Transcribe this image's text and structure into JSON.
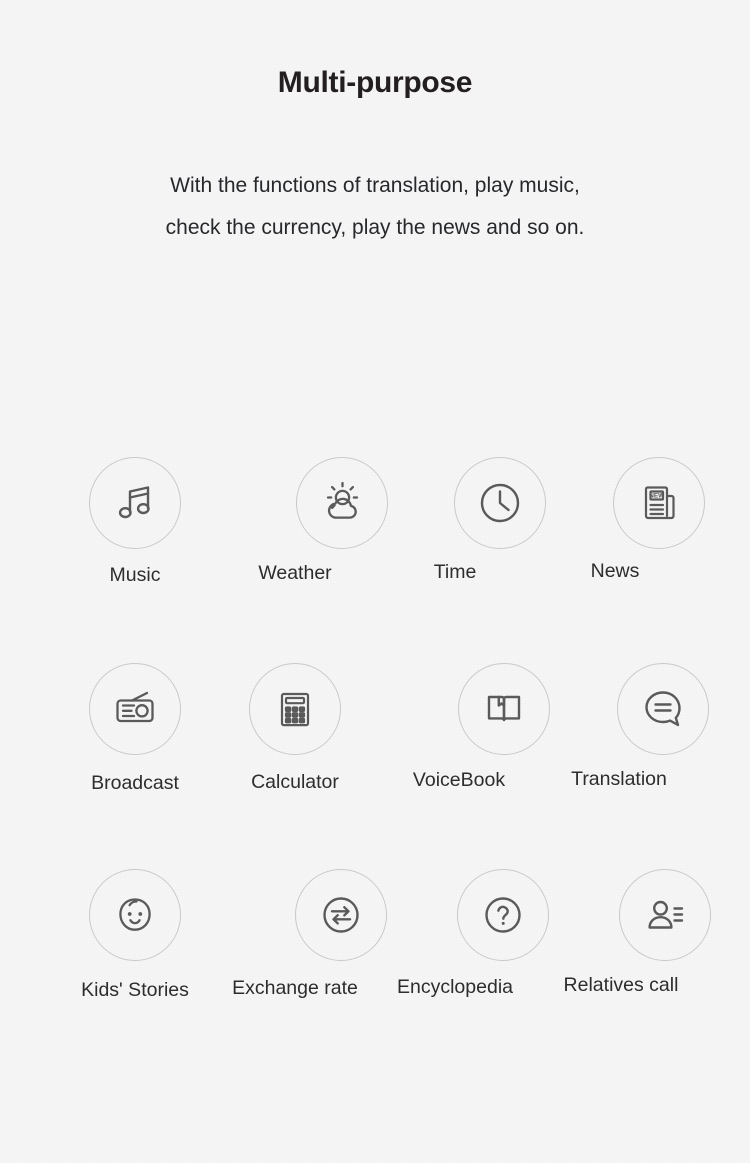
{
  "headline": "Multi-purpose",
  "subtitle": {
    "line1": "With the functions of translation, play music,",
    "line2": "check the currency, play the news and so on."
  },
  "colors": {
    "background": "#f5f5f5",
    "heading_text": "#231f20",
    "body_text": "#26282b",
    "circle_border": "#c9c9c9",
    "icon_stroke": "#5a5a5a"
  },
  "features": {
    "rows": [
      {
        "items": [
          {
            "label": "Music",
            "icon": "music-note-icon"
          },
          {
            "label": "Weather",
            "icon": "sun-behind-cloud-icon"
          },
          {
            "label": "Time",
            "icon": "clock-icon"
          },
          {
            "label": "News",
            "icon": "newspaper-icon",
            "icon_text": "NEW"
          }
        ]
      },
      {
        "items": [
          {
            "label": "Broadcast",
            "icon": "radio-icon"
          },
          {
            "label": "Calculator",
            "icon": "calculator-icon"
          },
          {
            "label": "VoiceBook",
            "icon": "open-book-icon"
          },
          {
            "label": "Translation",
            "icon": "speech-bubble-equals-icon"
          }
        ]
      },
      {
        "items": [
          {
            "label": "Kids' Stories",
            "icon": "baby-face-icon"
          },
          {
            "label": "Exchange rate",
            "icon": "exchange-arrows-circle-icon"
          },
          {
            "label": "Encyclopedia",
            "icon": "question-mark-circle-icon"
          },
          {
            "label": "Relatives call",
            "icon": "person-contact-list-icon"
          }
        ]
      }
    ]
  }
}
